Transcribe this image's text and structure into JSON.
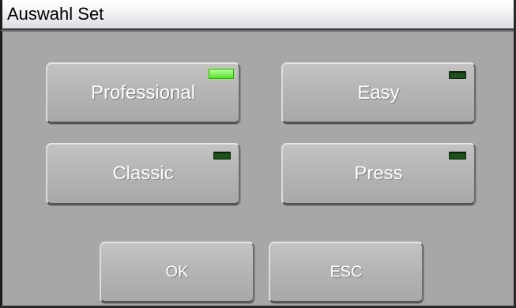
{
  "window": {
    "title": "Auswahl Set"
  },
  "sets": {
    "professional": {
      "label": "Professional",
      "active": true
    },
    "easy": {
      "label": "Easy",
      "active": false
    },
    "classic": {
      "label": "Classic",
      "active": false
    },
    "press": {
      "label": "Press",
      "active": false
    }
  },
  "actions": {
    "ok_label": "OK",
    "esc_label": "ESC"
  },
  "colors": {
    "background": "#a8a6a6",
    "led_on": "#6ee63f",
    "led_off": "#1f4f1f",
    "button_text": "#ffffff"
  }
}
